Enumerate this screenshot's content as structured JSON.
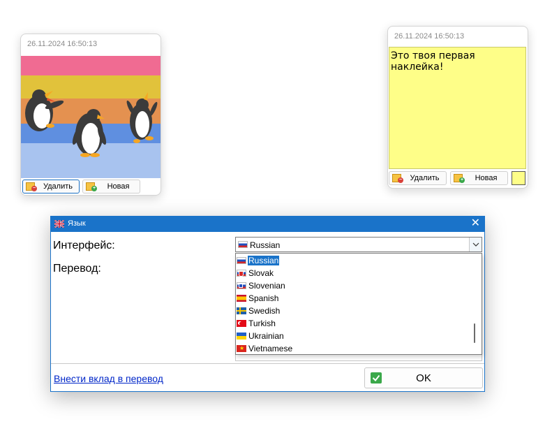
{
  "note1": {
    "date": "26.11.2024 16:50:13",
    "delete_label": "Удалить",
    "new_label": "Новая",
    "stripe_colors": [
      "#f06b92",
      "#e1c23b",
      "#e49150",
      "#5f8fe0",
      "#a8c3ef"
    ]
  },
  "note2": {
    "date": "26.11.2024 16:50:13",
    "text": "Это твоя первая наклейка!",
    "delete_label": "Удалить",
    "new_label": "Новая",
    "color": "#fefe88"
  },
  "dialog": {
    "title": "Язык",
    "close_glyph": "✕",
    "interface_label": "Интерфейс:",
    "translation_label": "Перевод:",
    "selected_language": "Russian",
    "languages": [
      "Russian",
      "Slovak",
      "Slovenian",
      "Spanish",
      "Swedish",
      "Turkish",
      "Ukrainian",
      "Vietnamese"
    ],
    "contribute_link": "Внести вклад в перевод",
    "ok_label": "OK",
    "accent_color": "#1a73c9"
  }
}
